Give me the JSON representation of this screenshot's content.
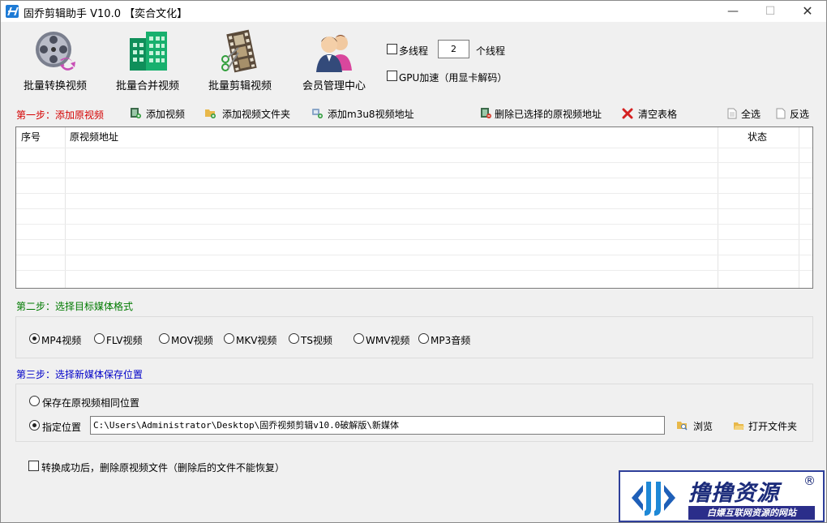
{
  "window": {
    "title": "固乔剪辑助手 V10.0 【奕合文化】",
    "minimize": "—",
    "maximize": "☐",
    "close": "✕"
  },
  "toolbar": [
    {
      "label": "批量转换视频",
      "icon": "film-reel-convert-icon"
    },
    {
      "label": "批量合并视频",
      "icon": "building-merge-icon"
    },
    {
      "label": "批量剪辑视频",
      "icon": "film-strip-scissors-icon"
    },
    {
      "label": "会员管理中心",
      "icon": "members-icon"
    }
  ],
  "options": {
    "multithread_label": "多线程",
    "thread_count": "2",
    "thread_unit": "个线程",
    "gpu_label": "GPU加速（用显卡解码）"
  },
  "step1": {
    "title": "第一步：添加原视频",
    "add_video": "添加视频",
    "add_folder": "添加视频文件夹",
    "add_m3u8": "添加m3u8视频地址",
    "delete_selected": "删除已选择的原视频地址",
    "clear_table": "清空表格",
    "select_all": "全选",
    "invert": "反选"
  },
  "table": {
    "columns": [
      "序号",
      "原视频地址",
      "状态"
    ],
    "rows": []
  },
  "step2": {
    "title": "第二步：选择目标媒体格式",
    "formats": [
      "MP4视频",
      "FLV视频",
      "MOV视频",
      "MKV视频",
      "TS视频",
      "WMV视频",
      "MP3音频"
    ],
    "selected": "MP4视频"
  },
  "step3": {
    "title": "第三步：选择新媒体保存位置",
    "same_location": "保存在原视频相同位置",
    "custom_location": "指定位置",
    "path": "C:\\Users\\Administrator\\Desktop\\固乔视频剪辑v10.0破解版\\新媒体",
    "browse": "浏览",
    "open_folder": "打开文件夹"
  },
  "delete_after": "转换成功后，删除原视频文件（删除后的文件不能恢复）",
  "watermark": {
    "title": "撸撸资源",
    "reg": "®",
    "subtitle": "白嫖互联网资源的网站"
  },
  "colors": {
    "step1": "#d40000",
    "step2": "#007a00",
    "step3": "#0000c8",
    "brand": "#1b2b7a"
  }
}
